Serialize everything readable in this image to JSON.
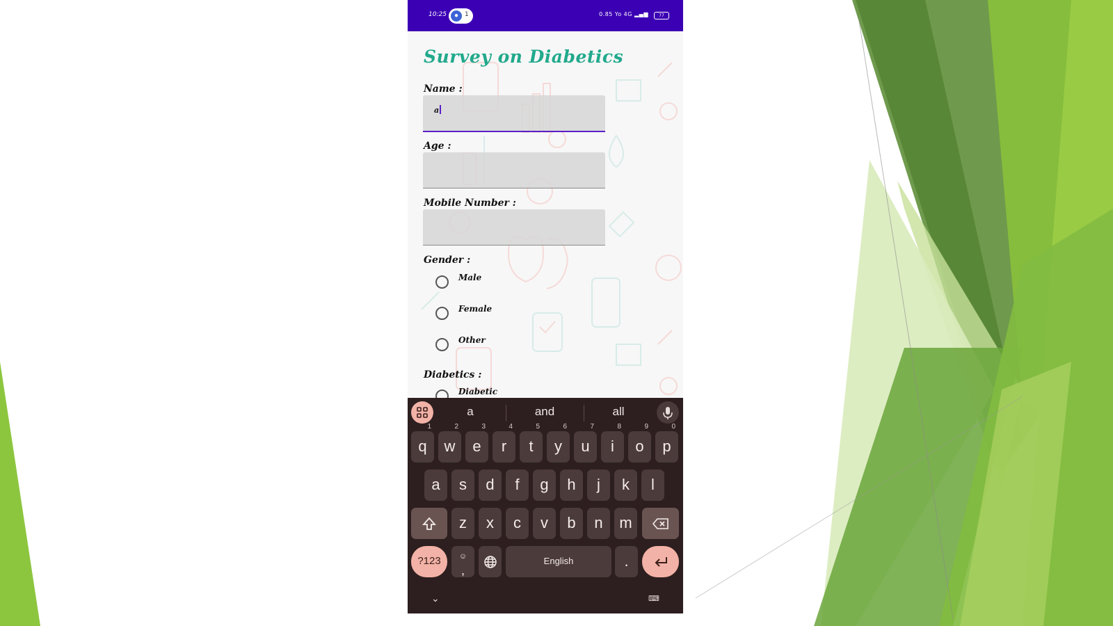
{
  "status_bar": {
    "time": "10:25",
    "notification_count": "1",
    "net_speed": "0.85",
    "net_labels": "Yo 4G",
    "battery": "77"
  },
  "form": {
    "title": "Survey on Diabetics",
    "name_label": "Name :",
    "name_value": "a",
    "age_label": "Age :",
    "mobile_label": "Mobile Number :",
    "gender_label": "Gender :",
    "gender_options": [
      "Male",
      "Female",
      "Other"
    ],
    "diabetics_label": "Diabetics :",
    "diabetics_options": [
      "Diabetic"
    ]
  },
  "keyboard": {
    "suggestions": [
      "a",
      "and",
      "all"
    ],
    "row1": [
      "q",
      "w",
      "e",
      "r",
      "t",
      "y",
      "u",
      "i",
      "o",
      "p"
    ],
    "row1_hints": [
      "1",
      "2",
      "3",
      "4",
      "5",
      "6",
      "7",
      "8",
      "9",
      "0"
    ],
    "row2": [
      "a",
      "s",
      "d",
      "f",
      "g",
      "h",
      "j",
      "k",
      "l"
    ],
    "row3": [
      "z",
      "x",
      "c",
      "v",
      "b",
      "n",
      "m"
    ],
    "symbols_label": "?123",
    "comma_label": ",",
    "space_label": "English",
    "period_label": "."
  },
  "colors": {
    "status_bar": "#3c00b4",
    "title": "#22a98c",
    "keyboard_bg": "#2d1f1f",
    "accent_key": "#f3b2a7",
    "field_focus": "#5a1ec8",
    "slide_green": "#7ab648"
  }
}
